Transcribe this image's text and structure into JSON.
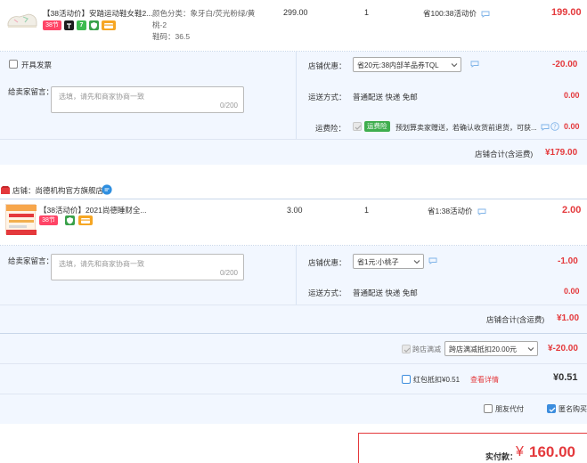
{
  "item1": {
    "title": "【38活动价】安踏运动鞋女鞋2...",
    "badge_38": "38节",
    "spec_line1": "颜色分类：象牙白/荧光粉绿/黄",
    "spec_line2": "桃-2",
    "spec_line3": "鞋码：36.5",
    "price": "299.00",
    "qty": "1",
    "promo": "省100:38活动价",
    "subtotal": "199.00"
  },
  "invoice_label": "开具发票",
  "store1_msg_label": "给卖家留言：",
  "store1_msg_placeholder": "选填，请先和商家协商一致",
  "store1_msg_count": "0/200",
  "store1_coupon_label": "店铺优惠：",
  "store1_coupon_value": "省20元:38内部羊品券TQL",
  "store1_coupon_amount": "-20.00",
  "store1_ship_label": "运送方式：",
  "store1_ship_value": "普通配送 快递 免邮",
  "store1_ship_amount": "0.00",
  "store1_ins_label": "运费险：",
  "store1_ins_badge": "运费险",
  "store1_ins_text": "预划算卖家赠送，若确认收货前退货，可获...",
  "store1_ins_amount": "0.00",
  "store1_total_label": "店铺合计(含运费)",
  "store1_total": "¥179.00",
  "store2_name": "店铺：尚德机构官方旗舰店",
  "item2": {
    "title": "【38活动价】2021尚德睡财全...",
    "badge_38": "38节",
    "price": "3.00",
    "qty": "1",
    "promo": "省1:38活动价",
    "subtotal": "2.00",
    "thumb_line1": "2021年初级会计职称",
    "thumb_line2": "全程班"
  },
  "store2_msg_label": "给卖家留言：",
  "store2_msg_placeholder": "选填，请先和商家协商一致",
  "store2_msg_count": "0/200",
  "store2_coupon_label": "店铺优惠：",
  "store2_coupon_value": "省1元:小桃子",
  "store2_coupon_amount": "-1.00",
  "store2_ship_label": "运送方式：",
  "store2_ship_value": "普通配送 快递 免邮",
  "store2_ship_amount": "0.00",
  "store2_total_label": "店铺合计(含运费)",
  "store2_total": "¥1.00",
  "cross_label": "跨店满减",
  "cross_value": "跨店满减抵扣20.00元",
  "cross_amount": "¥-20.00",
  "redpacket_label": "红包抵扣¥0.51",
  "redpacket_link": "查看详情",
  "redpacket_amount": "¥0.51",
  "friend_pay_label": "朋友代付",
  "anon_label": "匿名购买",
  "pay_label": "实付款：",
  "pay_currency": "¥",
  "pay_amount": "160.00",
  "colors": {
    "accent": "#e4393c",
    "blue": "#3c8dde",
    "band": "#f2f7ff"
  }
}
